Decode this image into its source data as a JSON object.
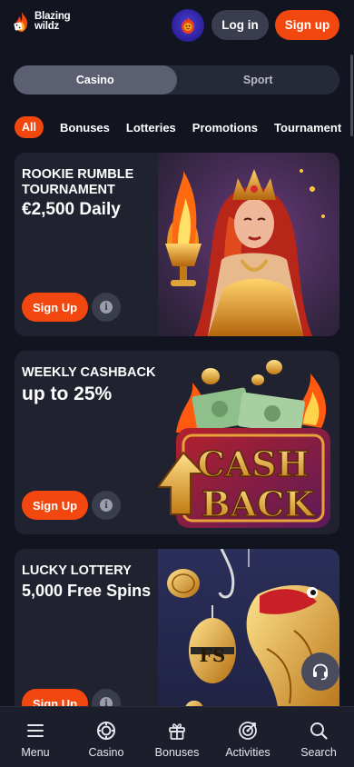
{
  "header": {
    "logo_line1": "Blazing",
    "logo_line2": "wildz",
    "login_label": "Log in",
    "signup_label": "Sign up"
  },
  "segment": {
    "tabs": [
      {
        "label": "Casino",
        "active": true
      },
      {
        "label": "Sport",
        "active": false
      }
    ]
  },
  "filters": {
    "items": [
      "All",
      "Bonuses",
      "Lotteries",
      "Promotions",
      "Tournament"
    ],
    "active": "All"
  },
  "cards": [
    {
      "kicker": "ROOKIE RUMBLE TOURNAMENT",
      "title": "€2,500 Daily",
      "button": "Sign Up",
      "art": "queen-with-flaming-chalice"
    },
    {
      "kicker": "WEEKLY CASHBACK",
      "title": "up to 25%",
      "button": "Sign Up",
      "art": "cash-back-wallet",
      "art_text_1": "CASH",
      "art_text_2": "BACK"
    },
    {
      "kicker": "LUCKY LOTTERY",
      "title": "5,000 Free Spins",
      "button": "Sign Up",
      "art": "golden-fish-lure",
      "art_text": "FS"
    }
  ],
  "bottom_nav": [
    {
      "label": "Menu",
      "icon": "menu-icon"
    },
    {
      "label": "Casino",
      "icon": "casino-chip-icon"
    },
    {
      "label": "Bonuses",
      "icon": "gift-icon"
    },
    {
      "label": "Activities",
      "icon": "target-icon"
    },
    {
      "label": "Search",
      "icon": "search-icon"
    }
  ],
  "colors": {
    "background": "#121420",
    "accent": "#f2480f",
    "card": "#20222f",
    "nav": "#1c1e2b"
  }
}
